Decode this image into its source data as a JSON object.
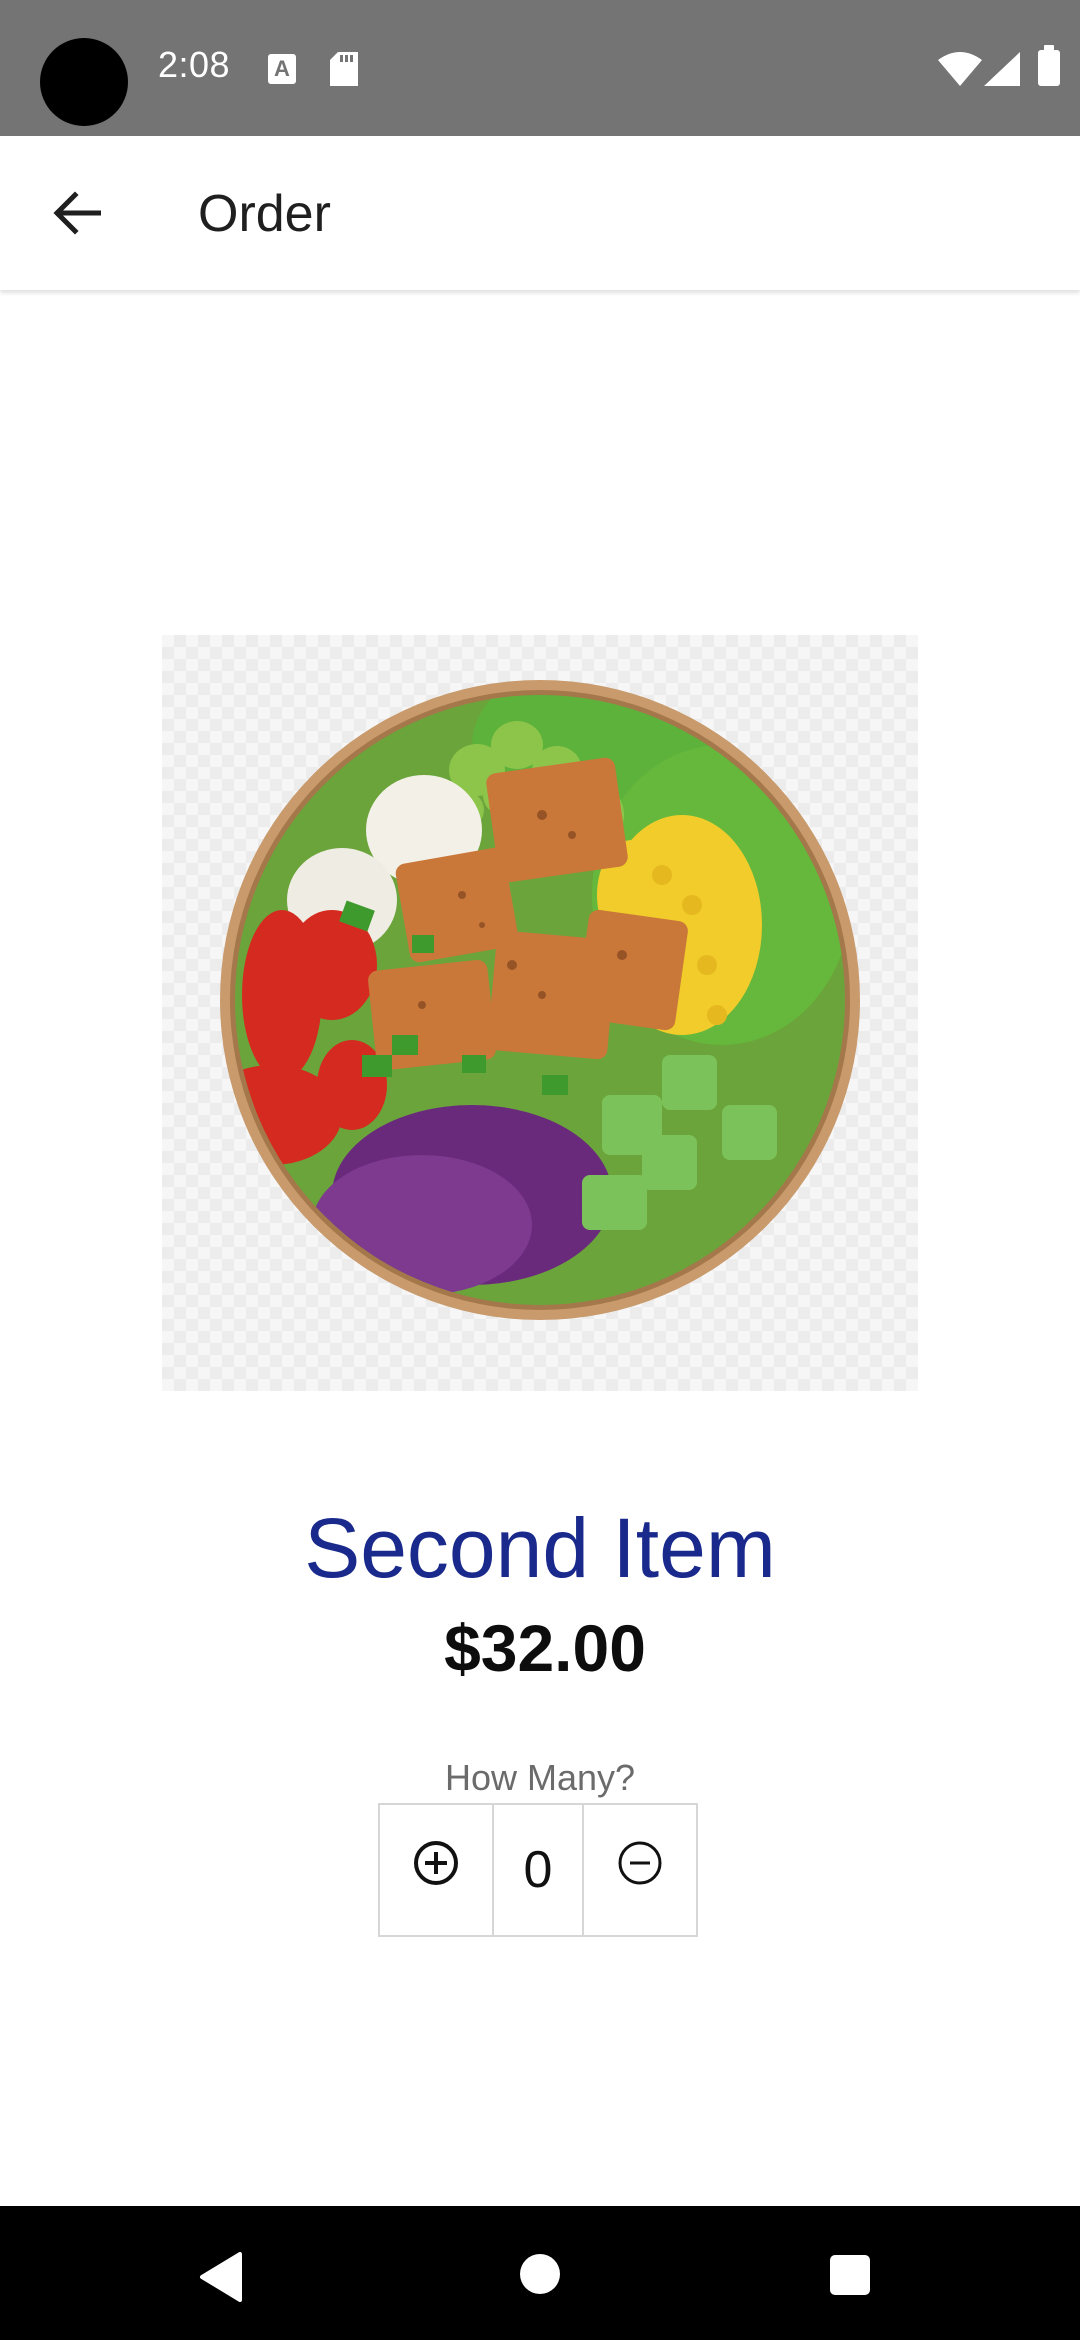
{
  "status_bar": {
    "time": "2:08",
    "icons": [
      "camera-cutout",
      "a-notification-icon",
      "sd-card-icon",
      "wifi-icon",
      "signal-icon",
      "battery-icon"
    ]
  },
  "app_bar": {
    "title": "Order",
    "back_icon": "arrow-back-icon"
  },
  "item": {
    "image": "salad-bowl-photo",
    "name": "Second Item",
    "price": "$32.00"
  },
  "quantity": {
    "label": "How Many?",
    "value": "0",
    "increment_icon": "plus-circle-icon",
    "decrement_icon": "minus-circle-icon"
  },
  "nav_bar": {
    "buttons": [
      "back-triangle-icon",
      "home-circle-icon",
      "recents-square-icon"
    ]
  },
  "colors": {
    "status_bar_bg": "#747474",
    "item_name": "#1a2a8c",
    "nav_bar_bg": "#000000"
  }
}
